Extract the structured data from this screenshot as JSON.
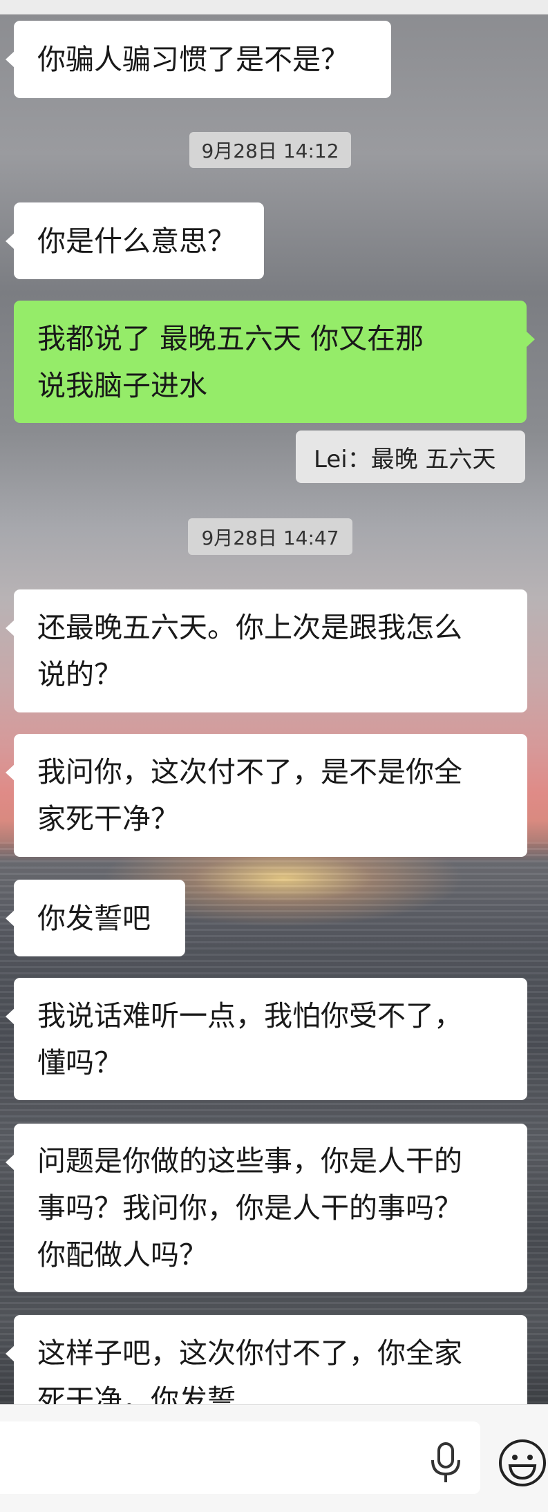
{
  "chat": {
    "messages": [
      {
        "side": "left",
        "text": "你骗人骗习惯了是不是？"
      },
      {
        "type": "time",
        "text": "9月28日 14:12"
      },
      {
        "side": "left",
        "text": "你是什么意思？"
      },
      {
        "side": "right",
        "lines": [
          "我都说了  最晚五六天   你又在那",
          "说我脑子进水"
        ]
      },
      {
        "type": "quote",
        "text": "Lei：最晚 五六天"
      },
      {
        "type": "time",
        "text": "9月28日 14:47"
      },
      {
        "side": "left",
        "lines": [
          "还最晚五六天。你上次是跟我怎么",
          "说的？"
        ]
      },
      {
        "side": "left",
        "lines": [
          "我问你，这次付不了，是不是你全",
          "家死干净？"
        ]
      },
      {
        "side": "left",
        "text": "你发誓吧"
      },
      {
        "side": "left",
        "lines": [
          "我说话难听一点，我怕你受不了，",
          "懂吗？"
        ]
      },
      {
        "side": "left",
        "lines": [
          "问题是你做的这些事，你是人干的",
          "事吗？我问你，你是人干的事吗？",
          "你配做人吗？"
        ]
      },
      {
        "side": "left",
        "lines": [
          "这样子吧，这次你付不了，你全家",
          "死干净，你发誓"
        ]
      }
    ]
  },
  "bottom_bar": {
    "voice_icon": "microphone-icon",
    "emoji_icon": "emoji-icon"
  }
}
